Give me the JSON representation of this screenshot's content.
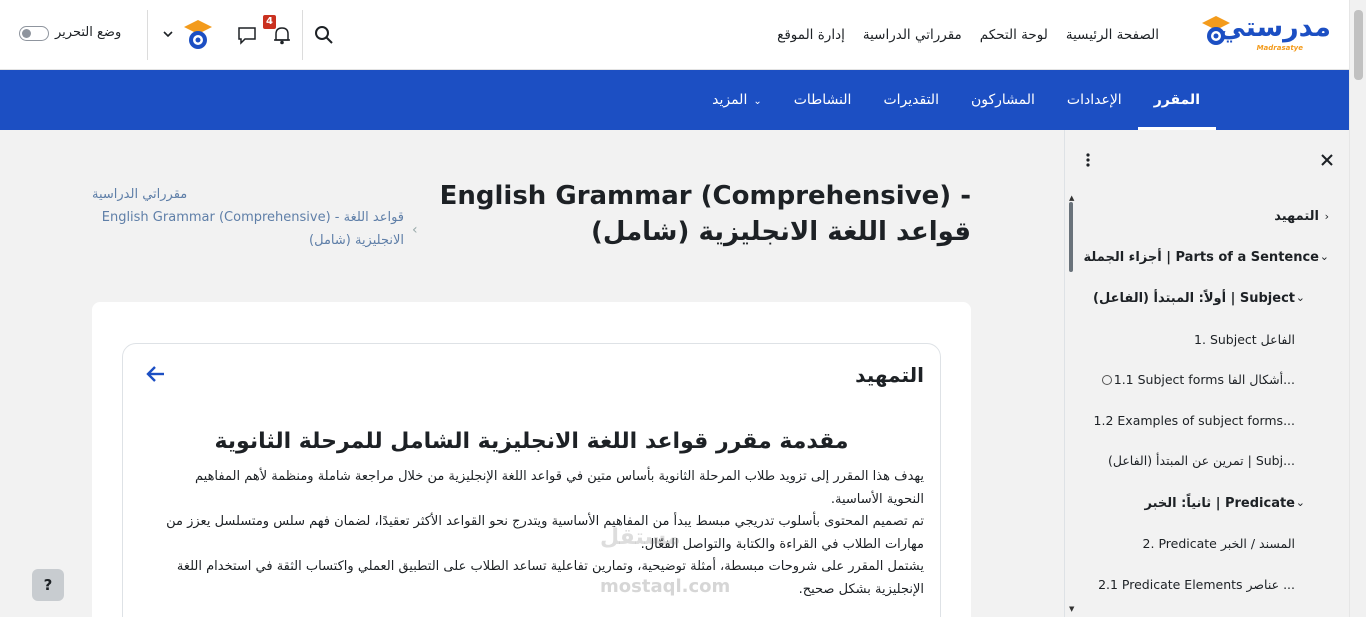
{
  "brand": {
    "name": "مدرستي",
    "sub": "Madrasatye"
  },
  "primary_nav": [
    "الصفحة الرئيسية",
    "لوحة التحكم",
    "مقرراتي الدراسية",
    "إدارة الموقع"
  ],
  "notifications_count": "4",
  "edit_mode_label": "وضع التحرير",
  "secondary_nav": {
    "items": [
      "المقرر",
      "الإعدادات",
      "المشاركون",
      "التقديرات",
      "النشاطات"
    ],
    "more": "المزيد"
  },
  "page_title": "English Grammar (Comprehensive) - قواعد اللغة الانجليزية (شامل)",
  "breadcrumb": {
    "first": "مقرراتي الدراسية",
    "second": "English Grammar (Comprehensive) - قواعد اللغة الانجليزية (شامل)"
  },
  "section": {
    "title": "التمهيد",
    "intro_title": "مقدمة مقرر قواعد اللغة الانجليزية الشامل للمرحلة الثانوية",
    "paragraphs": [
      "يهدف هذا المقرر إلى تزويد طلاب المرحلة الثانوية بأساس متين في قواعد اللغة الإنجليزية من خلال مراجعة شاملة ومنظمة لأهم المفاهيم النحوية الأساسية.",
      "تم تصميم المحتوى بأسلوب تدريجي مبسط يبدأ من المفاهيم الأساسية ويتدرج نحو القواعد الأكثر تعقيدًا، لضمان فهم سلس ومتسلسل يعزز من مهارات الطلاب في القراءة والكتابة والتواصل الفعّال.",
      "يشتمل المقرر على شروحات مبسطة، أمثلة توضيحية، وتمارين تفاعلية تساعد الطلاب على التطبيق العملي واكتساب الثقة في استخدام اللغة الإنجليزية بشكل صحيح."
    ]
  },
  "course_index": [
    {
      "label": "التمهيد",
      "type": "section"
    },
    {
      "label": "أجزاء الجملة | Parts of a Sentence",
      "type": "section"
    },
    {
      "label": "أولاً: المبتدأ (الفاعل) | Subject",
      "type": "section"
    },
    {
      "label": "1. Subject الفاعل",
      "type": "item"
    },
    {
      "label": "1.1 Subject forms أشكال الفا...",
      "type": "item"
    },
    {
      "label": "1.2 Examples of subject forms...",
      "type": "item"
    },
    {
      "label": "تمرين عن المبتدأ (الفاعل) | Subj...",
      "type": "item"
    },
    {
      "label": "ثانياً: الخبر | Predicate",
      "type": "section"
    },
    {
      "label": "2. Predicate المسند / الخبر",
      "type": "item"
    },
    {
      "label": "2.1 Predicate Elements عناصر ...",
      "type": "item"
    }
  ],
  "help_label": "?",
  "watermark": {
    "ar": "مستقل",
    "en": "mostaql.com"
  }
}
